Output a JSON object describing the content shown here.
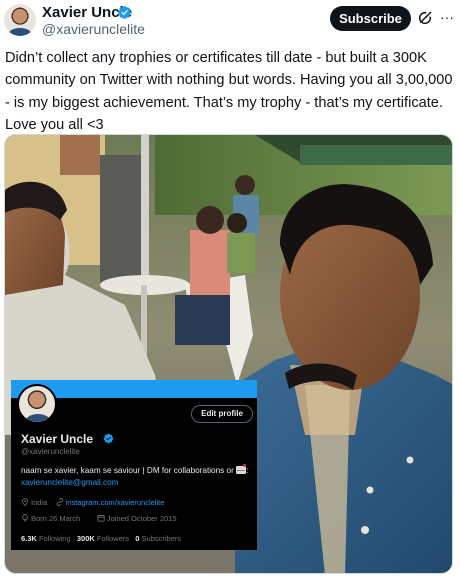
{
  "tweet": {
    "author_name": "Xavier Uncle",
    "author_handle": "@xavierunclelite",
    "subscribe_label": "Subscribe",
    "more_glyph": "···",
    "text": "Didn’t collect any trophies or certificates till date - but built a 300K community on Twitter with nothing but words. Having you all 3,00,000 - is my biggest achievement. That’s my trophy - that’s my certificate. Love you all <3"
  },
  "profile_card": {
    "edit_profile_label": "Edit profile",
    "name": "Xavier Uncle",
    "handle": "@xavierunclelite",
    "bio_text": "naam se xavier, kaam se saviour | DM for collaborations or",
    "bio_email": "xavierunclelite@gmail.com",
    "location": "India",
    "website": "instagram.com/xavierunclelite",
    "born": "Born 26 March",
    "joined": "Joined October 2015",
    "following_count": "6.3K",
    "following_label": "Following",
    "followers_count": "300K",
    "followers_label": "Followers",
    "subscribers_count": "0",
    "subscribers_label": "Subscribers"
  },
  "icons": {
    "verified": "verified-badge-icon",
    "grok": "grok-icon",
    "more": "more-icon",
    "mail": "mail-icon",
    "location": "location-pin-icon",
    "link": "link-icon",
    "birthday": "balloon-icon",
    "calendar": "calendar-icon"
  },
  "colors": {
    "accent_blue": "#1d9bf0",
    "text_primary": "#0f1419",
    "text_secondary": "#536471",
    "button_dark": "#0f1419",
    "card_background": "#000000"
  }
}
